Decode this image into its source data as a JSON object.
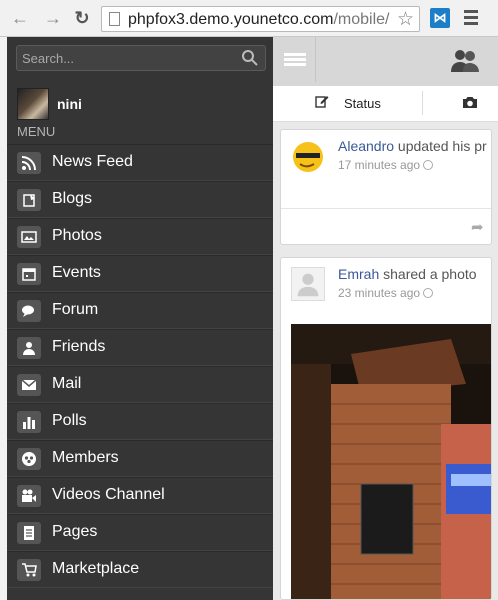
{
  "browser": {
    "url_host": "phpfox3.demo.younetco.com",
    "url_path": "/mobile/"
  },
  "sidebar": {
    "search_placeholder": "Search...",
    "user_name": "nini",
    "menu_label": "MENU",
    "items": [
      {
        "label": "News Feed",
        "icon": "rss-icon"
      },
      {
        "label": "Blogs",
        "icon": "blog-icon"
      },
      {
        "label": "Photos",
        "icon": "photo-icon"
      },
      {
        "label": "Events",
        "icon": "calendar-icon"
      },
      {
        "label": "Forum",
        "icon": "forum-icon"
      },
      {
        "label": "Friends",
        "icon": "friends-icon"
      },
      {
        "label": "Mail",
        "icon": "mail-icon"
      },
      {
        "label": "Polls",
        "icon": "poll-icon"
      },
      {
        "label": "Members",
        "icon": "members-icon"
      },
      {
        "label": "Videos Channel",
        "icon": "video-icon"
      },
      {
        "label": "Pages",
        "icon": "pages-icon"
      },
      {
        "label": "Marketplace",
        "icon": "cart-icon"
      }
    ]
  },
  "main": {
    "status_label": "Status",
    "posts": [
      {
        "actor": "Aleandro",
        "action": " updated his pr",
        "time": "17 minutes ago"
      },
      {
        "actor": "Emrah",
        "action": " shared a photo",
        "time": "23 minutes ago"
      }
    ]
  },
  "colors": {
    "sidebar_bg": "#353535",
    "link": "#3b5998",
    "topbar_bg": "#d7d7d7"
  }
}
